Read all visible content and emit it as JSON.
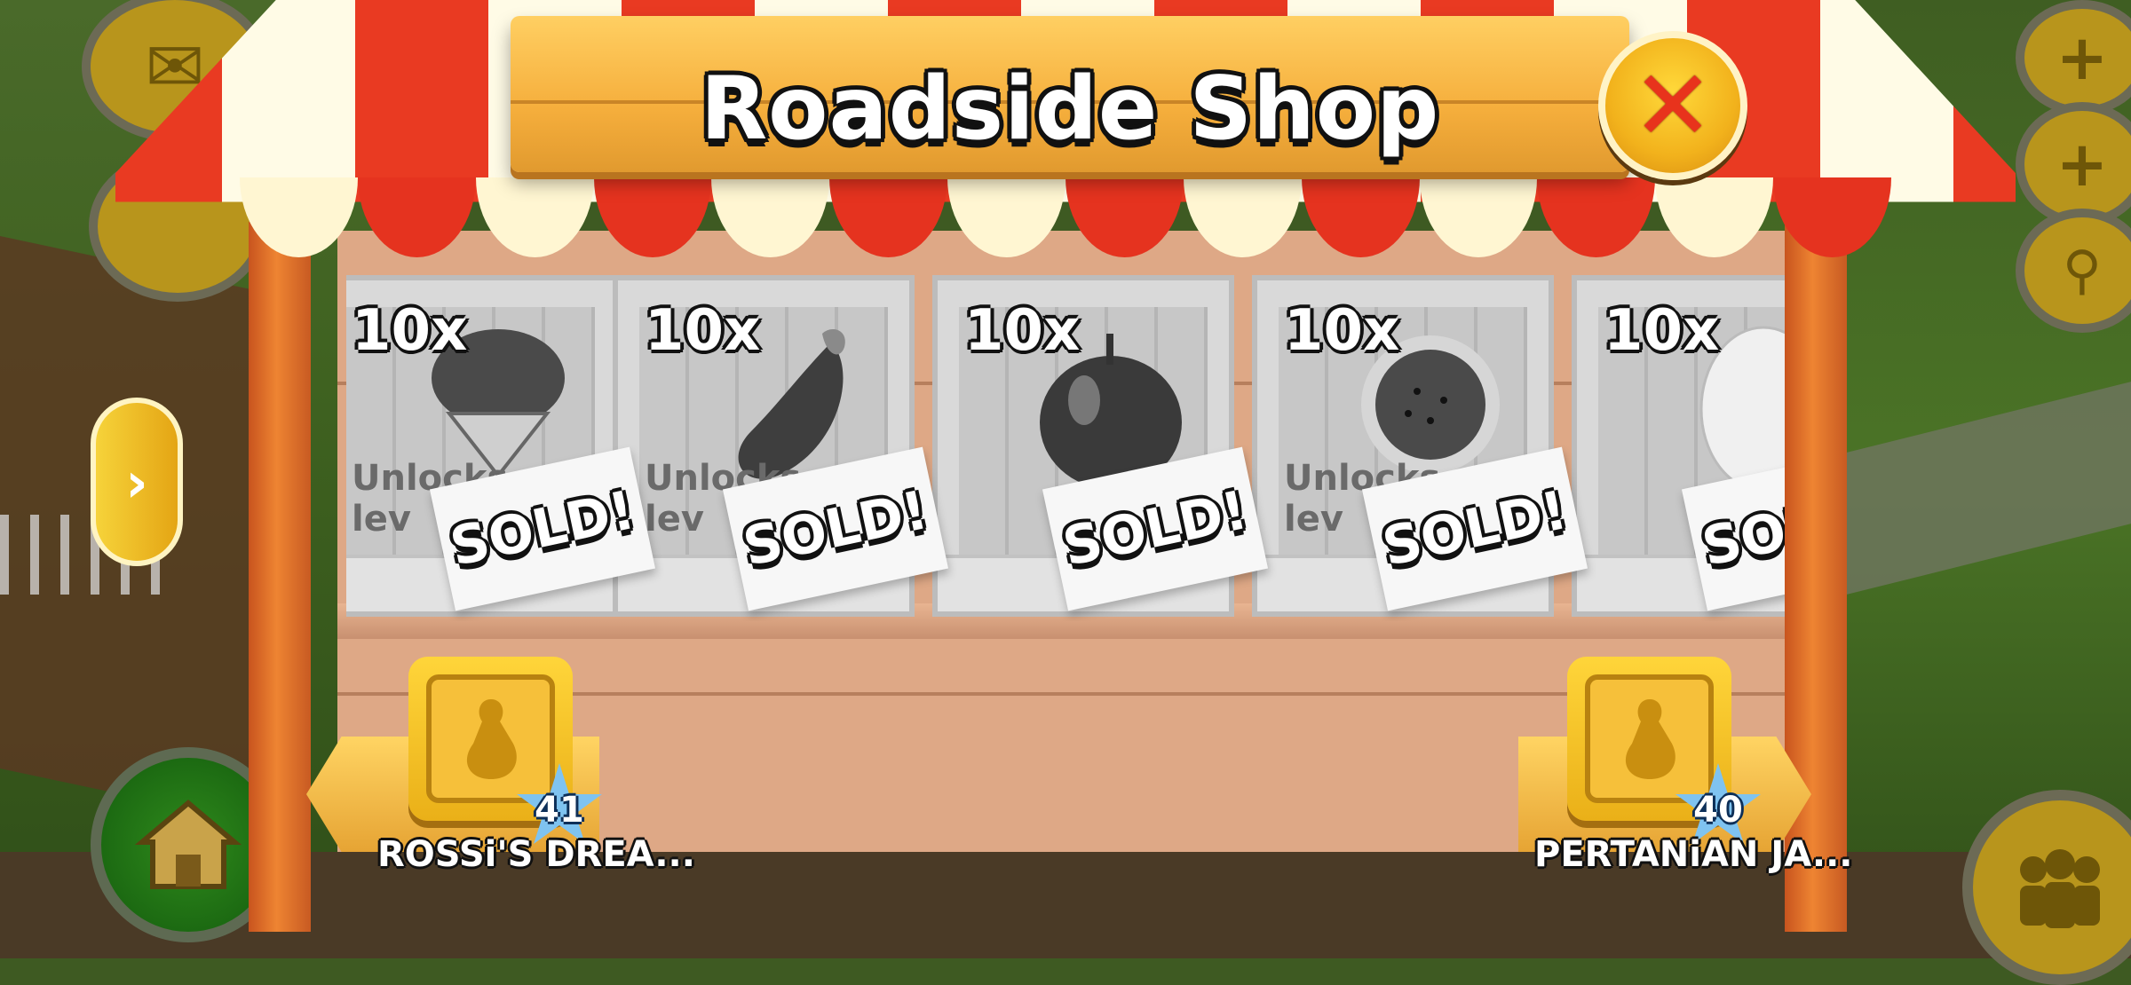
{
  "shop": {
    "title": "Roadside Shop",
    "close_symbol": "✕"
  },
  "nav": {
    "side_arrow_symbol": "›"
  },
  "crates": [
    {
      "quantity": "10x",
      "item": "pie",
      "unlocks_text": "Unlocks at\nlev",
      "status": "SOLD!"
    },
    {
      "quantity": "10x",
      "item": "eggplant",
      "unlocks_text": "Unlocks at\nlev",
      "status": "SOLD!"
    },
    {
      "quantity": "10x",
      "item": "apple",
      "unlocks_text": "",
      "status": "SOLD!"
    },
    {
      "quantity": "10x",
      "item": "watermelon",
      "unlocks_text": "Unlocks at\nlev",
      "status": "SOLD!"
    },
    {
      "quantity": "10x",
      "item": "egg",
      "unlocks_text": "",
      "status": "SOLD!"
    }
  ],
  "farmers": {
    "left": {
      "name": "ROSSi'S DREA...",
      "level": "41"
    },
    "right": {
      "name": "PERTANiAN JA...",
      "level": "40"
    }
  },
  "colors": {
    "awning_red": "#e93a22",
    "awning_cream": "#fffbe6",
    "board_orange": "#f5ae3c",
    "star_blue": "#7fc3f0"
  }
}
